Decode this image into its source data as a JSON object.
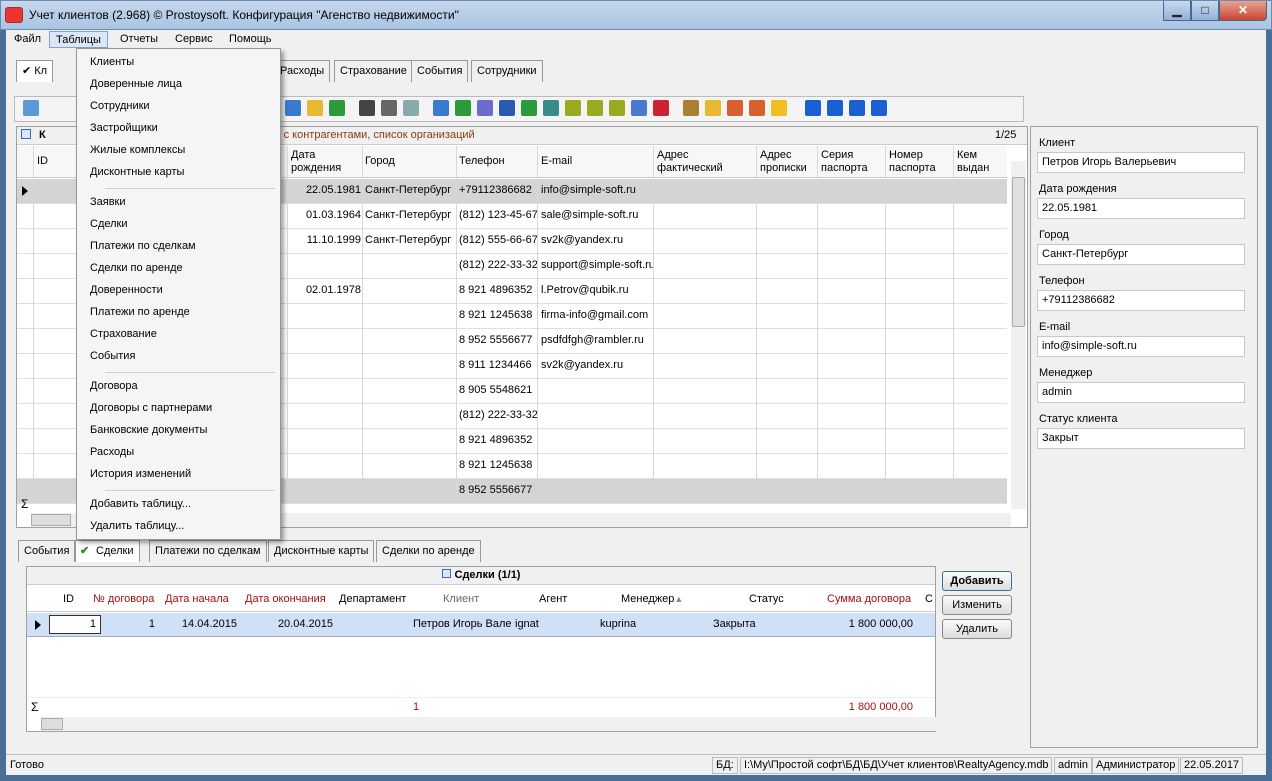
{
  "window": {
    "title": "Учет клиентов (2.968) © Prostoysoft. Конфигурация \"Агенство недвижимости\"",
    "min_glyph": "▁",
    "max_glyph": "□",
    "close_glyph": "✕"
  },
  "menubar": [
    "Файл",
    "Таблицы",
    "Отчеты",
    "Сервис",
    "Помощь"
  ],
  "tables_menu": {
    "group1": [
      "Клиенты",
      "Доверенные лица",
      "Сотрудники",
      "Застройщики",
      "Жилые комплексы",
      "Дисконтные карты"
    ],
    "group2": [
      "Заявки",
      "Сделки",
      "Платежи по сделкам",
      "Сделки по аренде",
      "Доверенности",
      "Платежи по аренде",
      "Страхование",
      "События"
    ],
    "group3": [
      "Договора",
      "Договоры с партнерами",
      "Банковские документы",
      "Расходы",
      "История изменений"
    ],
    "group4": [
      "Добавить таблицу...",
      "Удалить таблицу..."
    ]
  },
  "top_tabs": {
    "first": "✔ Кл",
    "visible": [
      "Расходы",
      "Страхование",
      "События",
      "Сотрудники"
    ]
  },
  "grid": {
    "caption_prefix": "К",
    "caption_text": "ица с контрагентами, список организаций",
    "page": "1/25",
    "headers": [
      "Дата рождения",
      "Город",
      "Телефон",
      "E-mail",
      "Адрес фактический",
      "Адрес прописки",
      "Серия паспорта",
      "Номер паспорта",
      "Кем выдан"
    ],
    "id_header": "ID",
    "rows": [
      {
        "birth": "22.05.1981",
        "city": "Санкт-Петербург",
        "phone": "+79112386682",
        "email": "info@simple-soft.ru"
      },
      {
        "birth": "01.03.1964",
        "city": "Санкт-Петербург",
        "phone": "(812) 123-45-67",
        "email": "sale@simple-soft.ru"
      },
      {
        "birth": "11.10.1999",
        "city": "Санкт-Петербург",
        "phone": "(812) 555-66-67",
        "email": "sv2k@yandex.ru"
      },
      {
        "birth": "",
        "city": "",
        "phone": "(812) 222-33-32",
        "email": "support@simple-soft.ru"
      },
      {
        "birth": "02.01.1978",
        "city": "",
        "phone": "8 921 4896352",
        "email": "l.Petrov@qubik.ru"
      },
      {
        "birth": "",
        "city": "",
        "phone": "8 921 1245638",
        "email": "firma-info@gmail.com"
      },
      {
        "birth": "",
        "city": "",
        "phone": "8 952 5556677",
        "email": "psdfdfgh@rambler.ru"
      },
      {
        "birth": "",
        "city": "",
        "phone": "8 911 1234466",
        "email": "sv2k@yandex.ru"
      },
      {
        "birth": "",
        "city": "",
        "phone": "8 905 5548621",
        "email": ""
      },
      {
        "birth": "",
        "city": "",
        "phone": "(812) 222-33-32",
        "email": ""
      },
      {
        "birth": "",
        "city": "",
        "phone": "8 921 4896352",
        "email": ""
      },
      {
        "birth": "",
        "city": "",
        "phone": "8 921 1245638",
        "email": ""
      },
      {
        "birth": "",
        "city": "",
        "phone": "8 952 5556677",
        "email": ""
      }
    ],
    "sigma": "Σ"
  },
  "detail": {
    "fields": [
      {
        "label": "Клиент",
        "value": "Петров Игорь Валерьевич"
      },
      {
        "label": "Дата рождения",
        "value": "22.05.1981"
      },
      {
        "label": "Город",
        "value": "Санкт-Петербург"
      },
      {
        "label": "Телефон",
        "value": "+79112386682"
      },
      {
        "label": "E-mail",
        "value": "info@simple-soft.ru"
      },
      {
        "label": "Менеджер",
        "value": "admin"
      },
      {
        "label": "Статус клиента",
        "value": "Закрыт"
      }
    ]
  },
  "bottom_tabs": [
    "События",
    "Сделки",
    "Платежи по сделкам",
    "Дисконтные карты",
    "Сделки по аренде"
  ],
  "deals": {
    "caption": "Сделки (1/1)",
    "headers": [
      "ID",
      "№ договора",
      "Дата начала",
      "Дата окончания",
      "Департамент",
      "Клиент",
      "Агент",
      "Менеджер",
      "Статус",
      "Сумма договора",
      "С"
    ],
    "sort_glyph": "▲",
    "row": {
      "id": "1",
      "number": "1",
      "start": "14.04.2015",
      "end": "20.04.2015",
      "department": "",
      "client": "Петров Игорь Вале",
      "agent": "ignat",
      "manager": "kuprina",
      "status": "Закрыта",
      "sum": "1 800 000,00"
    },
    "footer": {
      "sigma": "Σ",
      "count": "1",
      "total": "1 800 000,00"
    },
    "buttons": {
      "add": "Добавить",
      "edit": "Изменить",
      "delete": "Удалить"
    }
  },
  "statusbar": {
    "ready": "Готово",
    "db_label": "БД:",
    "db_path": "I:\\My\\Простой софт\\БД\\БД\\Учет клиентов\\RealtyAgency.mdb",
    "user": "admin",
    "role": "Администратор",
    "date": "22.05.2017"
  },
  "colors": {
    "selected_row": "#cfe0f7",
    "required_header": "#a01010",
    "close_button": "#c8452f",
    "check": "#2a8a2a"
  }
}
